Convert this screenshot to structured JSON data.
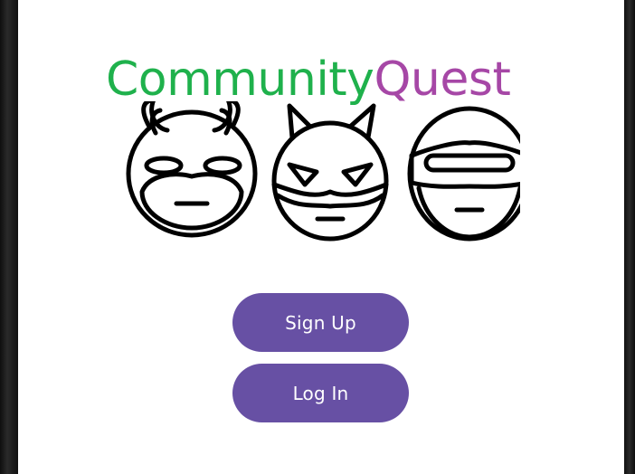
{
  "app": {
    "logo_part_1": "Community",
    "logo_part_2": "Quest",
    "logo_color_1": "#1fb14c",
    "logo_color_2": "#a647a6",
    "mascots": [
      "horned-devil-mask-icon",
      "cat-eared-mask-icon",
      "visor-helmet-icon"
    ]
  },
  "actions": {
    "signup_label": "Sign Up",
    "login_label": "Log In",
    "button_color": "#6750a4"
  }
}
